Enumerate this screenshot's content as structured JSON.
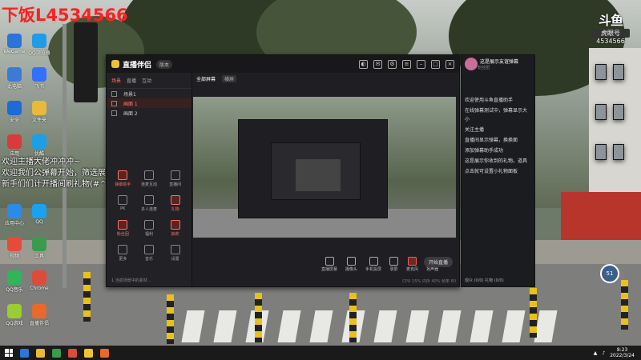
{
  "overlay": {
    "room_title": "下饭L4534566",
    "danmu": [
      "欢迎主播大佬冲冲冲~",
      "欢迎我们公弹幕开始，筛选展示版~",
      "新手们们计开播间刷礼物(#^O^#)"
    ],
    "brand_mark": "斗鱼",
    "brand_tag": "虎眼号",
    "room_id": "4534566",
    "badge_value": "51"
  },
  "desktop_icons": [
    {
      "label": "WeGame",
      "color": "#2b74d8"
    },
    {
      "label": "QQ浏览器",
      "color": "#1f9be8"
    },
    {
      "label": "此电脑",
      "color": "#3d7ad6"
    },
    {
      "label": "飞书",
      "color": "#3370ff"
    },
    {
      "label": "安全",
      "color": "#1d6ad8"
    },
    {
      "label": "文件夹",
      "color": "#e8b93a"
    },
    {
      "label": "应用",
      "color": "#d93a3a"
    },
    {
      "label": "优酷",
      "color": "#19a0e6"
    },
    {
      "label": "应用中心",
      "color": "#2b8be8"
    },
    {
      "label": "QQ",
      "color": "#18a2f0"
    },
    {
      "label": "视频",
      "color": "#e64a3a"
    },
    {
      "label": "工具",
      "color": "#3a9b4a"
    },
    {
      "label": "QQ音乐",
      "color": "#2fb55a"
    },
    {
      "label": "Chrome",
      "color": "#dd4b39"
    },
    {
      "label": "QQ游戏",
      "color": "#9acd32"
    },
    {
      "label": "直播伴侣",
      "color": "#e86a2a"
    }
  ],
  "app": {
    "title": "直播伴侣",
    "badge": "版本",
    "side_tabs": [
      "场景",
      "直播",
      "互动"
    ],
    "scenes": [
      {
        "label": "场景1",
        "selected": false
      },
      {
        "label": "画面 1",
        "selected": true
      },
      {
        "label": "画面 2",
        "selected": false
      }
    ],
    "tools": [
      {
        "label": "弹幕助手",
        "hot": true
      },
      {
        "label": "连麦互动",
        "hot": false
      },
      {
        "label": "直播间",
        "hot": false
      },
      {
        "label": "PK",
        "hot": false
      },
      {
        "label": "多人连麦",
        "hot": false
      },
      {
        "label": "礼物",
        "hot": true
      },
      {
        "label": "粉丝团",
        "hot": true
      },
      {
        "label": "福利",
        "hot": false
      },
      {
        "label": "抽奖",
        "hot": true
      },
      {
        "label": "更多",
        "hot": false
      },
      {
        "label": "音乐",
        "hot": false
      },
      {
        "label": "设置",
        "hot": false
      }
    ],
    "bottom_tip": "1.当前场景中的素材...",
    "top_tabs": [
      "全部屏幕",
      "横屏"
    ],
    "top_tag": "横屏",
    "controls": [
      {
        "label": "直播屏幕",
        "red": false
      },
      {
        "label": "摄像头",
        "red": false
      },
      {
        "label": "手机投屏",
        "red": false
      },
      {
        "label": "录屏",
        "red": false
      },
      {
        "label": "麦克风",
        "red": true
      },
      {
        "label": "扬声器",
        "red": true
      }
    ],
    "go_live": "开始直播",
    "status": "CPU 15%  内存 40%  帧率 60"
  },
  "chat": {
    "name": "这是展示友谊弹幕",
    "sub": "粉丝团",
    "messages": [
      "欢迎使用斗鱼直播助手",
      "在线弹幕测试中，弹幕显示大小",
      "关注主播",
      "直播间显示弹幕，换换面",
      "添加弹幕助手成功",
      "这是展示你收到的礼物。道具",
      "点击就可设置小礼物面板"
    ],
    "footer": "观众 (0/0) 礼物 (0/0)"
  },
  "taskbar": {
    "time": "8:23",
    "date": "2022/3/24",
    "icons": [
      "#2b74d8",
      "#e8b93a",
      "#3a9b4a",
      "#dd4b39",
      "#f1c232",
      "#e86a2a"
    ]
  }
}
